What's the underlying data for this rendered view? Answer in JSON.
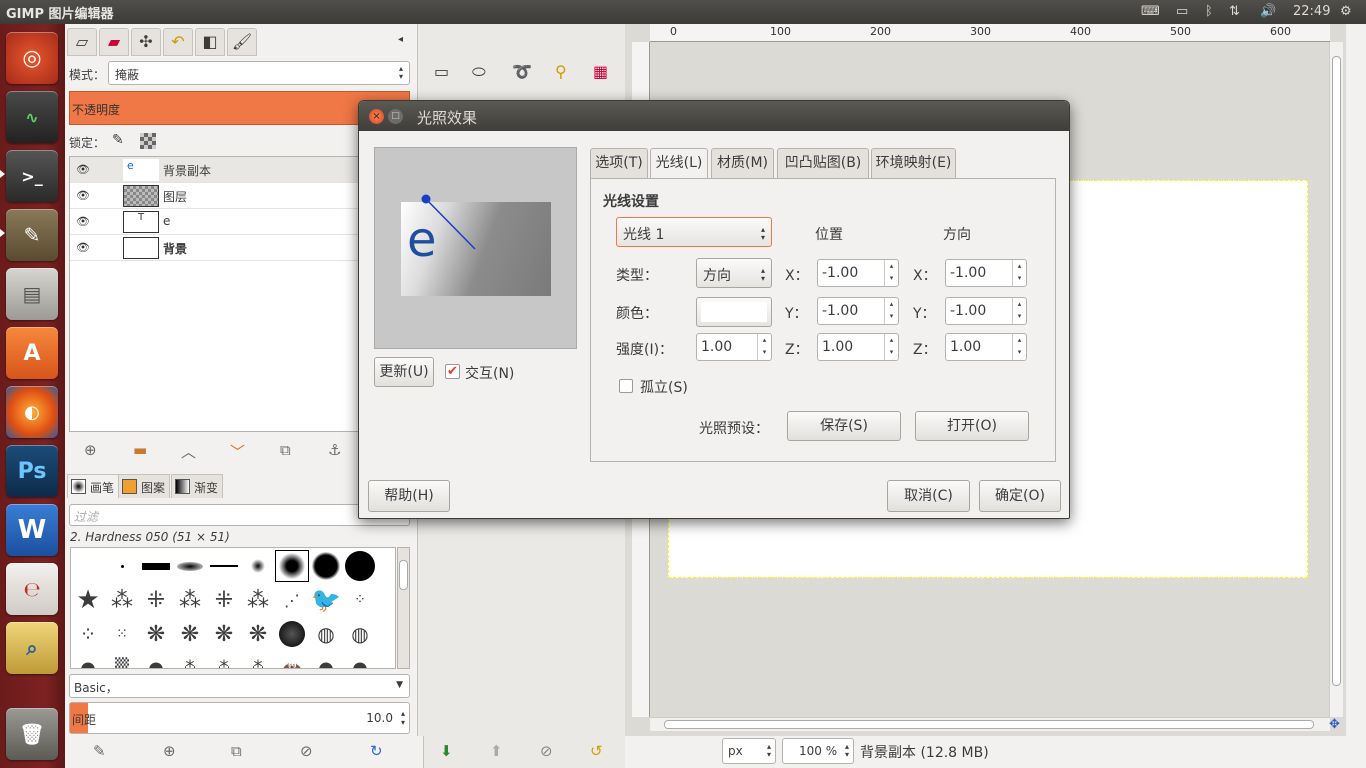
{
  "top_panel": {
    "app_title": "GIMP 图片编辑器",
    "clock": "22:49"
  },
  "launcher": {
    "items": [
      "ubuntu-dash",
      "system-monitor",
      "terminal",
      "gimp",
      "file-manager",
      "software-center",
      "firefox",
      "photoshop",
      "wps-writer",
      "document-viewer",
      "image-viewer",
      "trash"
    ],
    "photoshop_label": "Ps",
    "software_center_label": "A"
  },
  "layers_dock": {
    "mode_label": "模式：",
    "mode_value": "掩蔽",
    "opacity_label": "不透明度",
    "lock_label": "锁定：",
    "layers": [
      {
        "name": "背景副本",
        "bold": false
      },
      {
        "name": "图层",
        "bold": false
      },
      {
        "name": "e",
        "bold": false
      },
      {
        "name": "背景",
        "bold": true
      }
    ]
  },
  "brushes_dock": {
    "tabs": [
      "画笔",
      "图案",
      "渐变"
    ],
    "filter_placeholder": "过滤",
    "brush_name": "2. Hardness 050 (51 × 51)",
    "tag_value": "Basic，",
    "spacing_label": "间距",
    "spacing_value": "10.0"
  },
  "canvas": {
    "ruler_ticks": [
      "0",
      "100",
      "200",
      "300",
      "400",
      "500",
      "600"
    ],
    "unit": "px",
    "zoom": "100 %",
    "status": "背景副本 (12.8 MB)"
  },
  "dialog": {
    "title": "光照效果",
    "update_button": "更新(U)",
    "interactive_label": "交互(N)",
    "interactive_checked": true,
    "help_button": "帮助(H)",
    "cancel_button": "取消(C)",
    "ok_button": "确定(O)",
    "tabs": [
      "选项(T)",
      "光线(L)",
      "材质(M)",
      "凹凸贴图(B)",
      "环境映射(E)"
    ],
    "active_tab": 1,
    "section_title": "光线设置",
    "light_select": "光线 1",
    "position_header": "位置",
    "direction_header": "方向",
    "type_label": "类型：",
    "type_value": "方向",
    "color_label": "颜色：",
    "color_value": "#ffffff",
    "intensity_label": "强度(I)：",
    "intensity_value": "1.00",
    "isolate_label": "孤立(S)",
    "isolate_checked": false,
    "position": {
      "x": "-1.00",
      "y": "-1.00",
      "z": "1.00"
    },
    "direction": {
      "x": "-1.00",
      "y": "-1.00",
      "z": "1.00"
    },
    "axis_labels": {
      "x": "X：",
      "y": "Y：",
      "z": "Z："
    },
    "preset_label": "光照预设：",
    "save_button": "保存(S)",
    "open_button": "打开(O)",
    "preview_glyph": "e"
  },
  "colors": {
    "accent": "#f07746",
    "launcher_bg": "#7d2222",
    "panel_bg": "#3c3b37"
  }
}
